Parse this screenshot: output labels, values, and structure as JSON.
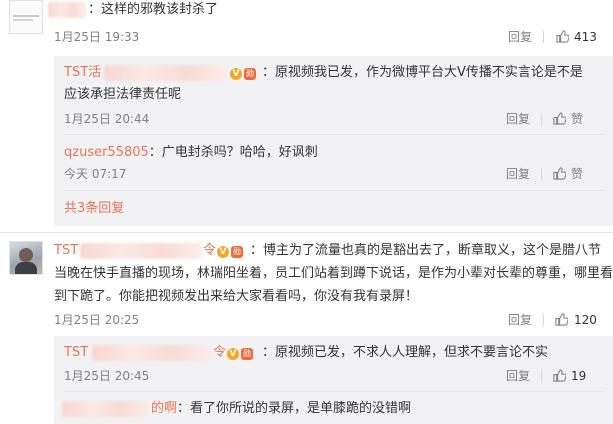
{
  "comment1": {
    "text": "：这样的邪教该封杀了",
    "time": "1月25日 19:33",
    "reply_label": "回复",
    "like_count": "413"
  },
  "reply1": {
    "name": "TST活",
    "text_line1": "：原视频我已发，作为微博平台大V传播不实言论是不是",
    "text_line2": "应该承担法律责任呢",
    "time": "1月25日 20:44",
    "reply_label": "回复",
    "like_label": "赞"
  },
  "reply2": {
    "name": "qzuser55805",
    "text": "：广电封杀吗？哈哈，好讽刺",
    "time": "今天 07:17",
    "reply_label": "回复",
    "like_label": "赞"
  },
  "more_replies": "共3条回复",
  "comment2": {
    "name": "TST",
    "name_tail": "令",
    "text_line1": "：博主为了流量也真的是豁出去了，断章取义，这个是腊八节",
    "text_line2": "当晚在快手直播的现场，林瑞阳坐着，员工们站着到蹲下说话，是作为小辈对长辈的尊重，哪里看",
    "text_line3": "到下跪了。你能把视频发出来给大家看看吗，你没有我有录屏！",
    "time": "1月25日 20:25",
    "reply_label": "回复",
    "like_count": "120"
  },
  "reply3": {
    "name": "TST",
    "name_tail": "令",
    "text": "：原视频已发，不求人人理解，但求不要言论不实",
    "time": "1月25日 20:45",
    "reply_label": "回复",
    "like_count": "19"
  },
  "reply4": {
    "name_tail": "的啊",
    "text": "：看了你所说的录屏，是单膝跪的没错啊"
  },
  "badges": {
    "v": "V",
    "medal": "勋"
  },
  "colors": {
    "name": "#eb7350",
    "sub_bg": "#f2f2f5",
    "meta": "#808080"
  }
}
